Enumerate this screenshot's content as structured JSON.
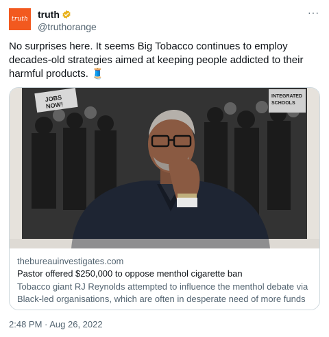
{
  "account": {
    "avatar_text": "truth",
    "display_name": "truth",
    "handle": "@truthorange"
  },
  "more_label": "···",
  "tweet": {
    "text": "No surprises here. It seems Big Tobacco continues to employ decades-old strategies aimed at keeping people addicted to their harmful products. 🧵",
    "timestamp": "2:48 PM · Aug 26, 2022"
  },
  "card": {
    "image_signs": [
      "JOBS",
      "NOW!",
      "INTEGRATED SCHOOLS"
    ],
    "domain": "thebureauinvestigates.com",
    "title": "Pastor offered $250,000 to oppose menthol cigarette ban",
    "description": "Tobacco giant RJ Reynolds attempted to influence the menthol debate via Black-led organisations, which are often in desperate need of more funds"
  },
  "colors": {
    "avatar_bg": "#f2591f",
    "verified": "#e8b21e",
    "secondary_text": "#536471",
    "border": "#cfd9de"
  }
}
